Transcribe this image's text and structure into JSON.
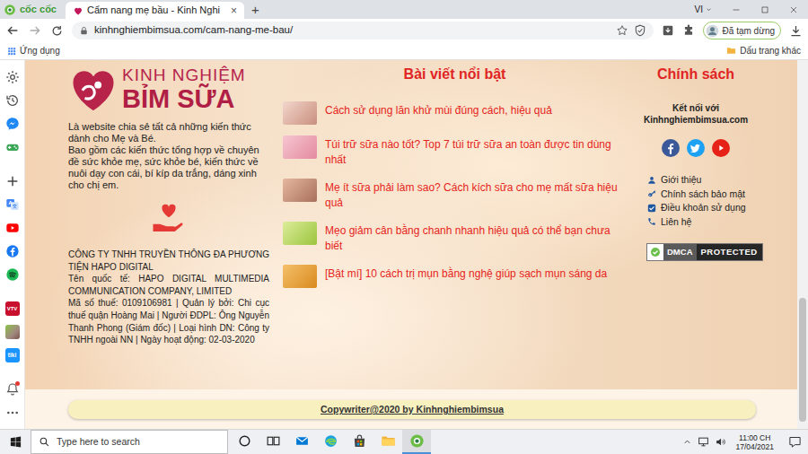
{
  "browser": {
    "logo": "cốc cốc",
    "tabs": [
      {
        "label": "Cẩm nang mẹ bầu - Kinh Nghi",
        "selected": true
      }
    ],
    "tab_close": "×",
    "new_tab": "+",
    "language": "VI",
    "url": "kinhnghiembimsua.com/cam-nang-me-bau/",
    "profile": "Đã tạm dừng",
    "bookmarks": {
      "apps": "Ứng dụng",
      "other": "Dấu trang khác"
    }
  },
  "sidebar": {
    "items": [
      {
        "kind": "gear"
      },
      {
        "kind": "history"
      },
      {
        "kind": "messenger"
      },
      {
        "kind": "game"
      },
      {
        "kind": "plus"
      },
      {
        "kind": "translate"
      },
      {
        "kind": "youtube"
      },
      {
        "kind": "facebook"
      },
      {
        "kind": "spotify"
      },
      {
        "kind": "vtv",
        "label": "VTV"
      },
      {
        "kind": "photo"
      },
      {
        "kind": "tiki",
        "label": "tiki"
      },
      {
        "kind": "bell",
        "unread": true
      },
      {
        "kind": "more"
      }
    ]
  },
  "page": {
    "brand": {
      "top": "KINH NGHIỆM",
      "bottom": "BỈM SỮA"
    },
    "intro": [
      "Là website chia sẻ tất cả những kiến thức dành cho Mẹ và Bé.",
      "Bao gồm các kiến thức tổng hợp về chuyên đề sức khỏe mẹ, sức khỏe bé, kiến thức về nuôi dạy con cái, bí kíp da trắng, dáng xinh cho chị em."
    ],
    "company": [
      "CÔNG TY TNHH TRUYỀN THÔNG ĐA PHƯƠNG TIỆN HAPO DIGITAL",
      "Tên quốc tế: HAPO DIGITAL MULTIMEDIA COMMUNICATION COMPANY, LIMITED",
      "Mã số thuế: 0109106981 | Quản lý bởi: Chi cục thuế quận Hoàng Mai | Người ĐDPL: Ông Nguyễn Thanh Phong (Giám đốc) | Loại hình DN: Công ty TNHH ngoài NN | Ngày hoạt động: 02-03-2020"
    ],
    "featured": {
      "title": "Bài viết nổi bật",
      "articles": [
        {
          "title": "Cách sử dụng lăn khử mùi đúng cách, hiệu quả"
        },
        {
          "title": "Túi trữ sữa nào tốt? Top 7 túi trữ sữa an toàn được tin dùng nhất"
        },
        {
          "title": "Mẹ ít sữa phải làm sao? Cách kích sữa cho mẹ mất sữa hiệu quả"
        },
        {
          "title": "Mẹo giảm cân bằng chanh nhanh hiệu quả có thể bạn chưa biết"
        },
        {
          "title": "[Bật mí] 10 cách trị mụn bằng nghệ giúp sạch mụn sáng da"
        }
      ]
    },
    "policy": {
      "title": "Chính sách",
      "connect": [
        "Kết nối với",
        "Kinhnghiembimsua.com"
      ],
      "social": [
        {
          "kind": "facebook"
        },
        {
          "kind": "twitter"
        },
        {
          "kind": "youtube"
        }
      ],
      "links": [
        {
          "label": "Giới thiệu",
          "kind": "user"
        },
        {
          "label": "Chính sách bảo mật",
          "kind": "key"
        },
        {
          "label": "Điều khoản sử dụng",
          "kind": "check"
        },
        {
          "label": "Liên hệ",
          "kind": "phone"
        }
      ],
      "dmca": [
        "DMCA",
        "PROTECTED"
      ]
    },
    "copyright": "Copywriter@2020 by Kinhnghiembimsua"
  },
  "taskbar": {
    "search": {
      "placeholder": "Type here to search"
    },
    "apps": [
      {
        "kind": "cortana",
        "selected": false
      },
      {
        "kind": "taskview",
        "selected": false
      },
      {
        "kind": "mail",
        "selected": false
      },
      {
        "kind": "edge",
        "selected": false
      },
      {
        "kind": "store",
        "selected": false
      },
      {
        "kind": "explorer",
        "selected": false
      },
      {
        "kind": "coccoc",
        "selected": true
      }
    ],
    "time": "11:00 CH",
    "date": "17/04/2021"
  }
}
